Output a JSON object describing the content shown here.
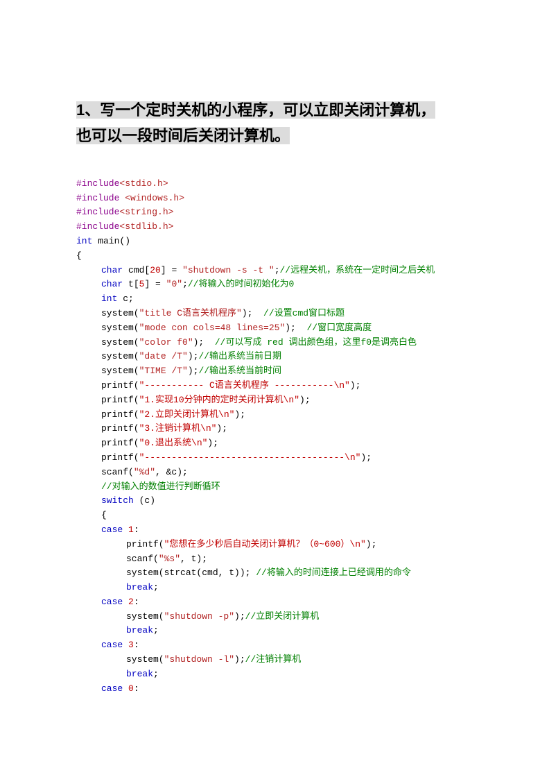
{
  "title_line1": "1、写一个定时关机的小程序，可以立即关闭计算机，",
  "title_line2": "也可以一段时间后关闭计算机。",
  "lines": [
    {
      "cls": "",
      "parts": [
        {
          "c": "mag",
          "t": "#include"
        },
        {
          "c": "dred",
          "t": "<stdio.h>"
        }
      ]
    },
    {
      "cls": "",
      "parts": [
        {
          "c": "mag",
          "t": "#include "
        },
        {
          "c": "dred",
          "t": "<windows.h>"
        }
      ]
    },
    {
      "cls": "",
      "parts": [
        {
          "c": "mag",
          "t": "#include"
        },
        {
          "c": "dred",
          "t": "<string.h>"
        }
      ]
    },
    {
      "cls": "",
      "parts": [
        {
          "c": "mag",
          "t": "#include"
        },
        {
          "c": "dred",
          "t": "<stdlib.h>"
        }
      ]
    },
    {
      "cls": "",
      "parts": [
        {
          "c": "kw",
          "t": "int"
        },
        {
          "t": " main()"
        }
      ]
    },
    {
      "cls": "",
      "parts": [
        {
          "t": "{"
        }
      ]
    },
    {
      "cls": "ind1",
      "parts": [
        {
          "c": "kw",
          "t": "char"
        },
        {
          "t": " cmd["
        },
        {
          "c": "num",
          "t": "20"
        },
        {
          "t": "] = "
        },
        {
          "c": "dred",
          "t": "\"shutdown -s -t \""
        },
        {
          "t": ";"
        },
        {
          "c": "grn",
          "t": "//远程关机，系统在一定时间之后关机"
        }
      ]
    },
    {
      "cls": "ind1",
      "parts": [
        {
          "c": "kw",
          "t": "char"
        },
        {
          "t": " t["
        },
        {
          "c": "num",
          "t": "5"
        },
        {
          "t": "] = "
        },
        {
          "c": "dred",
          "t": "\"0\""
        },
        {
          "t": ";"
        },
        {
          "c": "grn",
          "t": "//将输入的时间初始化为0"
        }
      ]
    },
    {
      "cls": "ind1",
      "parts": [
        {
          "c": "kw",
          "t": "int"
        },
        {
          "t": " c;"
        }
      ]
    },
    {
      "cls": "ind1",
      "parts": [
        {
          "t": "system("
        },
        {
          "c": "dred",
          "t": "\"title C语言关机程序\""
        },
        {
          "t": ");  "
        },
        {
          "c": "grn",
          "t": "//设置cmd窗口标题"
        }
      ]
    },
    {
      "cls": "ind1",
      "parts": [
        {
          "t": "system("
        },
        {
          "c": "dred",
          "t": "\"mode con cols=48 lines=25\""
        },
        {
          "t": ");  "
        },
        {
          "c": "grn",
          "t": "//窗口宽度高度"
        }
      ]
    },
    {
      "cls": "ind1",
      "parts": [
        {
          "t": "system("
        },
        {
          "c": "dred",
          "t": "\"color f0\""
        },
        {
          "t": ");  "
        },
        {
          "c": "grn",
          "t": "//可以写成 red 调出颜色组，这里f0是调亮白色"
        }
      ]
    },
    {
      "cls": "ind1",
      "parts": [
        {
          "t": "system("
        },
        {
          "c": "dred",
          "t": "\"date /T\""
        },
        {
          "t": ");"
        },
        {
          "c": "grn",
          "t": "//输出系统当前日期"
        }
      ]
    },
    {
      "cls": "ind1",
      "parts": [
        {
          "t": "system("
        },
        {
          "c": "dred",
          "t": "\"TIME /T\""
        },
        {
          "t": ");"
        },
        {
          "c": "grn",
          "t": "//输出系统当前时间"
        }
      ]
    },
    {
      "cls": "ind1",
      "parts": [
        {
          "t": "printf("
        },
        {
          "c": "red",
          "t": "\"----------- C语言关机程序 -----------\\n\""
        },
        {
          "t": ");"
        }
      ]
    },
    {
      "cls": "ind1",
      "parts": [
        {
          "t": "printf("
        },
        {
          "c": "red",
          "t": "\"1.实现10分钟内的定时关闭计算机\\n\""
        },
        {
          "t": ");"
        }
      ]
    },
    {
      "cls": "ind1",
      "parts": [
        {
          "t": "printf("
        },
        {
          "c": "red",
          "t": "\"2.立即关闭计算机\\n\""
        },
        {
          "t": ");"
        }
      ]
    },
    {
      "cls": "ind1",
      "parts": [
        {
          "t": "printf("
        },
        {
          "c": "red",
          "t": "\"3.注销计算机\\n\""
        },
        {
          "t": ");"
        }
      ]
    },
    {
      "cls": "ind1",
      "parts": [
        {
          "t": "printf("
        },
        {
          "c": "red",
          "t": "\"0.退出系统\\n\""
        },
        {
          "t": ");"
        }
      ]
    },
    {
      "cls": "ind1",
      "parts": [
        {
          "t": "printf("
        },
        {
          "c": "red",
          "t": "\"-------------------------------------\\n\""
        },
        {
          "t": ");"
        }
      ]
    },
    {
      "cls": "ind1",
      "parts": [
        {
          "t": "scanf("
        },
        {
          "c": "dred",
          "t": "\"%d\""
        },
        {
          "t": ", &c);"
        }
      ]
    },
    {
      "cls": "ind1",
      "parts": [
        {
          "c": "grn",
          "t": "//对输入的数值进行判断循环"
        }
      ]
    },
    {
      "cls": "ind1",
      "parts": [
        {
          "c": "kw",
          "t": "switch"
        },
        {
          "t": " (c)"
        }
      ]
    },
    {
      "cls": "ind1",
      "parts": [
        {
          "t": "{"
        }
      ]
    },
    {
      "cls": "ind1",
      "parts": [
        {
          "c": "kw",
          "t": "case"
        },
        {
          "t": " "
        },
        {
          "c": "num",
          "t": "1"
        },
        {
          "t": ":"
        }
      ]
    },
    {
      "cls": "ind2",
      "parts": [
        {
          "t": "printf("
        },
        {
          "c": "red",
          "t": "\"您想在多少秒后自动关闭计算机？（0~600）\\n\""
        },
        {
          "t": ");"
        }
      ]
    },
    {
      "cls": "ind2",
      "parts": [
        {
          "t": "scanf("
        },
        {
          "c": "dred",
          "t": "\"%s\""
        },
        {
          "t": ", t);"
        }
      ]
    },
    {
      "cls": "ind2",
      "parts": [
        {
          "t": "system(strcat(cmd, t)); "
        },
        {
          "c": "grn",
          "t": "//将输入的时间连接上已经调用的命令"
        }
      ]
    },
    {
      "cls": "ind2",
      "parts": [
        {
          "c": "kw",
          "t": "break"
        },
        {
          "t": ";"
        }
      ]
    },
    {
      "cls": "ind1",
      "parts": [
        {
          "c": "kw",
          "t": "case"
        },
        {
          "t": " "
        },
        {
          "c": "num",
          "t": "2"
        },
        {
          "t": ":"
        }
      ]
    },
    {
      "cls": "ind2",
      "parts": [
        {
          "t": "system("
        },
        {
          "c": "dred",
          "t": "\"shutdown -p\""
        },
        {
          "t": ");"
        },
        {
          "c": "grn",
          "t": "//立即关闭计算机"
        }
      ]
    },
    {
      "cls": "ind2",
      "parts": [
        {
          "c": "kw",
          "t": "break"
        },
        {
          "t": ";"
        }
      ]
    },
    {
      "cls": "ind1",
      "parts": [
        {
          "c": "kw",
          "t": "case"
        },
        {
          "t": " "
        },
        {
          "c": "num",
          "t": "3"
        },
        {
          "t": ":"
        }
      ]
    },
    {
      "cls": "ind2",
      "parts": [
        {
          "t": "system("
        },
        {
          "c": "dred",
          "t": "\"shutdown -l\""
        },
        {
          "t": ");"
        },
        {
          "c": "grn",
          "t": "//注销计算机"
        }
      ]
    },
    {
      "cls": "ind2",
      "parts": [
        {
          "c": "kw",
          "t": "break"
        },
        {
          "t": ";"
        }
      ]
    },
    {
      "cls": "ind1",
      "parts": [
        {
          "c": "kw",
          "t": "case"
        },
        {
          "t": " "
        },
        {
          "c": "num",
          "t": "0"
        },
        {
          "t": ":"
        }
      ]
    }
  ]
}
